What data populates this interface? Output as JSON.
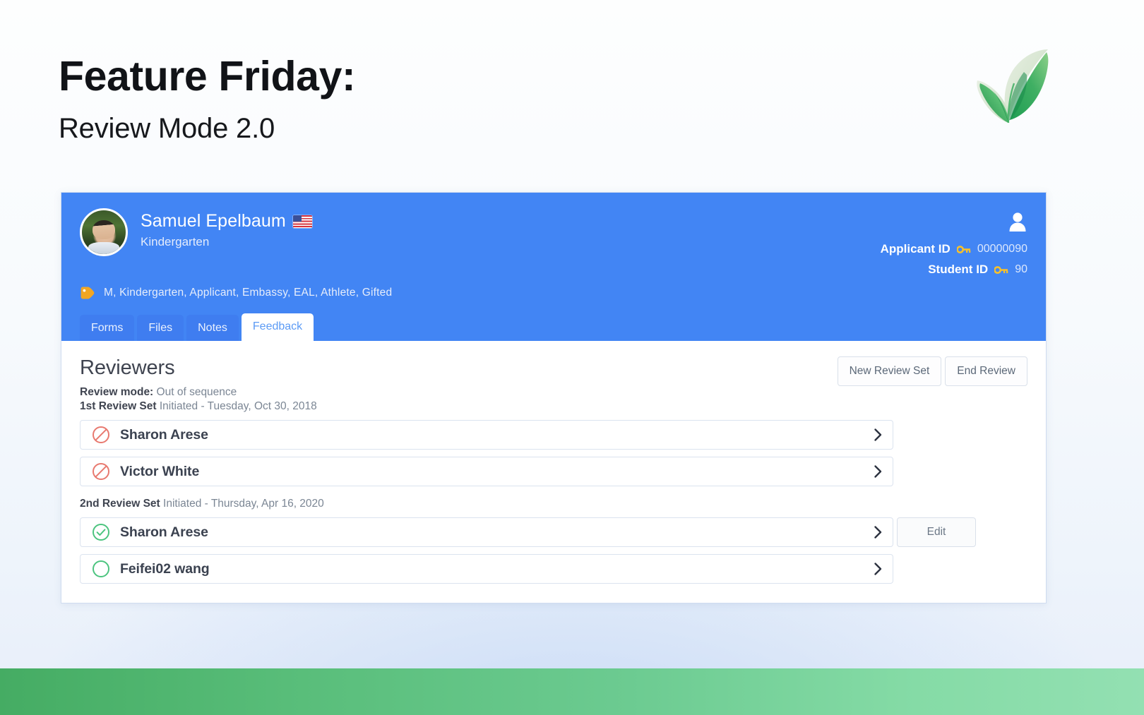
{
  "slide": {
    "title": "Feature Friday:",
    "subtitle": "Review Mode 2.0",
    "logo_icon": "green-leaf-checkmark-logo",
    "accent_green": "#4CAF6E",
    "accent_blue": "#4285F4"
  },
  "profile": {
    "avatar_icon": "student-photo-avatar",
    "name": "Samuel Epelbaum",
    "flag_icon": "us-flag-icon",
    "grade": "Kindergarten",
    "person_icon": "person-icon",
    "tag_icon": "tag-icon",
    "tags": "M, Kindergarten, Applicant,  Embassy,  EAL,  Athlete,  Gifted",
    "ids": [
      {
        "label": "Applicant ID",
        "icon": "key-icon",
        "value": "00000090"
      },
      {
        "label": "Student ID",
        "icon": "key-icon",
        "value": "90"
      }
    ]
  },
  "tabs": [
    {
      "label": "Forms",
      "active": false
    },
    {
      "label": "Files",
      "active": false
    },
    {
      "label": "Notes",
      "active": false
    },
    {
      "label": "Feedback",
      "active": true
    }
  ],
  "panel": {
    "heading": "Reviewers",
    "review_mode_label": "Review mode:",
    "review_mode_value": "Out of sequence",
    "actions": [
      {
        "label": "New Review Set"
      },
      {
        "label": "End Review"
      }
    ],
    "sets": [
      {
        "label": "1st Review Set",
        "meta": "Initiated - Tuesday, Oct 30, 2018",
        "reviewers": [
          {
            "name": "Sharon Arese",
            "status_icon": "blocked-circle-icon",
            "status_color": "#e8796f",
            "chevron_icon": "chevron-right-icon",
            "edit_label": null
          },
          {
            "name": "Victor White",
            "status_icon": "blocked-circle-icon",
            "status_color": "#e8796f",
            "chevron_icon": "chevron-right-icon",
            "edit_label": null
          }
        ]
      },
      {
        "label": "2nd Review Set",
        "meta": "Initiated - Thursday, Apr 16, 2020",
        "reviewers": [
          {
            "name": "Sharon Arese",
            "status_icon": "check-circle-icon",
            "status_color": "#4cc47f",
            "chevron_icon": "chevron-right-icon",
            "edit_label": "Edit"
          },
          {
            "name": "Feifei02 wang",
            "status_icon": "empty-circle-icon",
            "status_color": "#4cc47f",
            "chevron_icon": "chevron-right-icon",
            "edit_label": null
          }
        ]
      }
    ]
  }
}
